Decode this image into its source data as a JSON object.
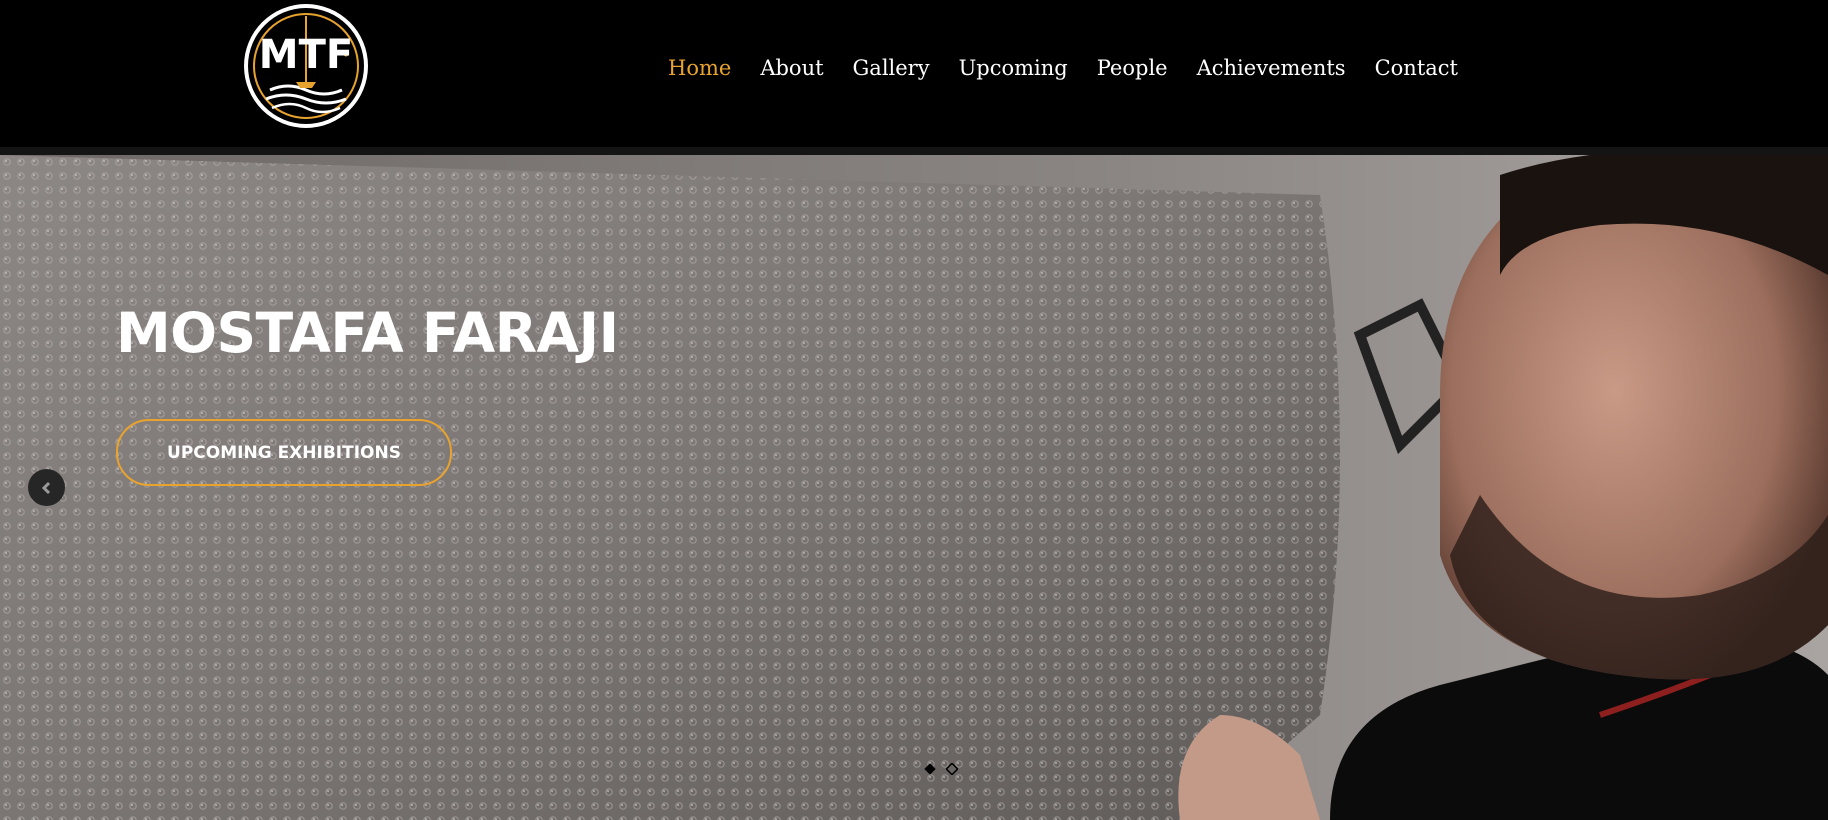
{
  "header": {
    "logo_text": "MTF",
    "nav": [
      {
        "label": "Home",
        "active": true
      },
      {
        "label": "About",
        "active": false
      },
      {
        "label": "Gallery",
        "active": false
      },
      {
        "label": "Upcoming",
        "active": false
      },
      {
        "label": "People",
        "active": false
      },
      {
        "label": "Achievements",
        "active": false
      },
      {
        "label": "Contact",
        "active": false
      }
    ]
  },
  "hero": {
    "title": "MOSTAFA FARAJI",
    "cta_label": "UPCOMING EXHIBITIONS",
    "prev_icon": "chevron-left-icon",
    "slide_count": 2,
    "active_slide": 1
  },
  "colors": {
    "accent": "#e8a32e",
    "header_bg": "#000000",
    "text": "#ffffff"
  }
}
